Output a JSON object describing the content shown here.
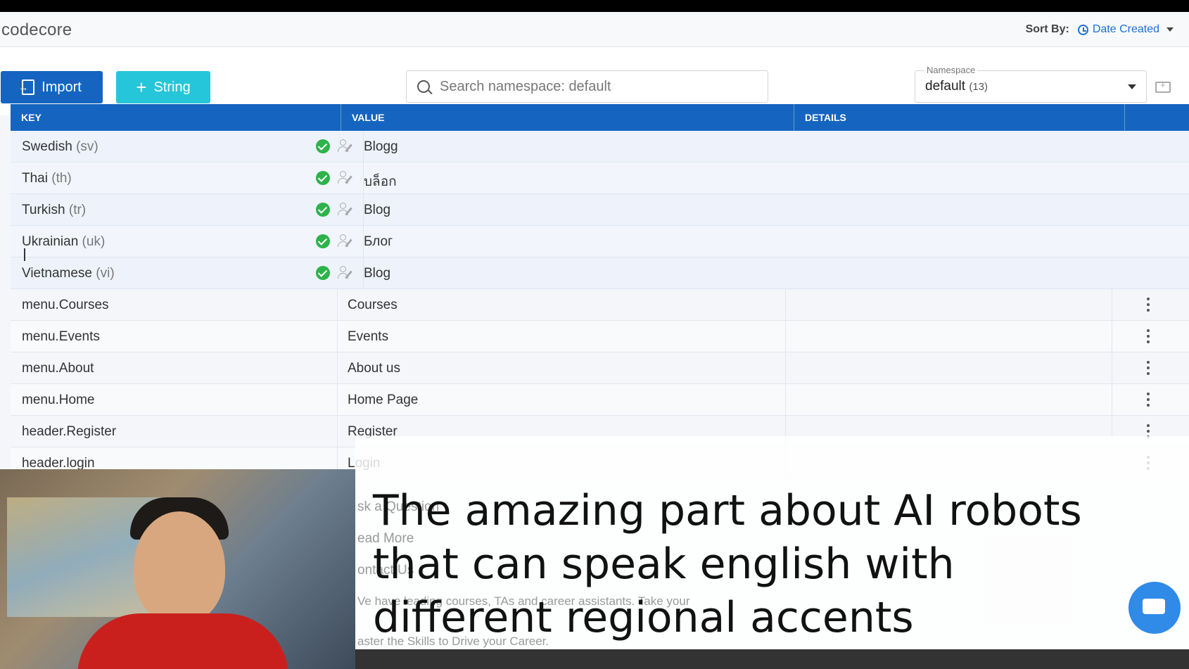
{
  "header": {
    "brand": "codecore",
    "sort_label": "Sort By:",
    "sort_value": "Date Created"
  },
  "toolbar": {
    "import_label": "Import",
    "string_label": "String",
    "search_placeholder": "Search namespace: default",
    "namespace_label": "Namespace",
    "namespace_value": "default",
    "namespace_count": "(13)"
  },
  "table": {
    "headers": {
      "key": "KEY",
      "value": "VALUE",
      "details": "DETAILS"
    },
    "languages": [
      {
        "name": "Swedish",
        "code": "(sv)",
        "value": "Blogg"
      },
      {
        "name": "Thai",
        "code": "(th)",
        "value": "บล็อก"
      },
      {
        "name": "Turkish",
        "code": "(tr)",
        "value": "Blog"
      },
      {
        "name": "Ukrainian",
        "code": "(uk)",
        "value": "Блог"
      },
      {
        "name": "Vietnamese",
        "code": "(vi)",
        "value": "Blog"
      }
    ],
    "keys": [
      {
        "key": "menu.Courses",
        "value": "Courses"
      },
      {
        "key": "menu.Events",
        "value": "Events"
      },
      {
        "key": "menu.About",
        "value": "About us"
      },
      {
        "key": "menu.Home",
        "value": "Home Page"
      },
      {
        "key": "header.Register",
        "value": "Register"
      },
      {
        "key": "header.login",
        "value": "Login"
      }
    ],
    "faded_values": [
      "sk a Question",
      "ead More",
      "ontact Us",
      "Ve have leading courses, TAs and career assistants. Take your",
      "aster the Skills to Drive your Career."
    ]
  },
  "subtitle": "The amazing part about AI robots that can speak english with different regional accents",
  "colors": {
    "accent": "#1565c0",
    "teal": "#26c6da",
    "check": "#2cb34a"
  }
}
